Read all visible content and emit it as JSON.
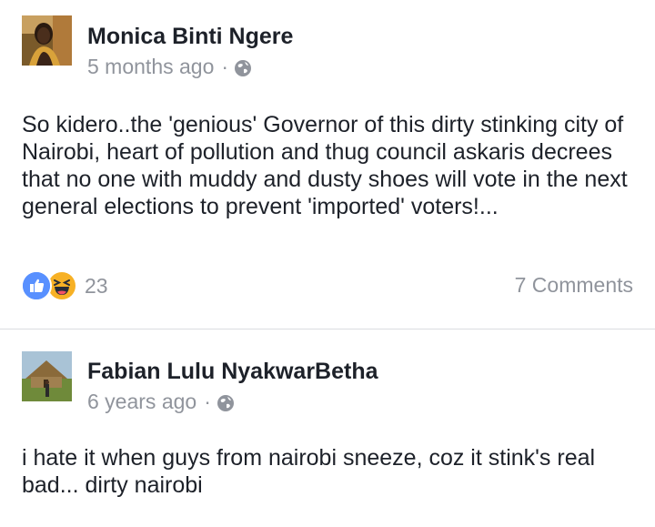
{
  "posts": [
    {
      "author": "Monica Binti Ngere",
      "time": "5 months ago",
      "separator": "·",
      "privacy_icon": "globe-icon",
      "text": "So kidero..the 'genious' Governor of this dirty stinking city of Nairobi, heart of pollution and thug council askaris decrees that no one with muddy and dusty shoes will vote in the next general elections to prevent 'imported' voters!...",
      "reactions": {
        "icons": [
          "like-icon",
          "haha-icon"
        ],
        "count": "23"
      },
      "comments_label": "7 Comments"
    },
    {
      "author": "Fabian Lulu NyakwarBetha",
      "time": "6 years ago",
      "separator": "·",
      "privacy_icon": "globe-icon",
      "text": "i hate it when guys from nairobi sneeze, coz it stink's real bad... dirty nairobi"
    }
  ],
  "colors": {
    "like_blue": "#5890ff",
    "haha_yellow": "#f7b125",
    "meta_gray": "#90949c",
    "text_dark": "#1d2129",
    "divider": "#dadde1"
  }
}
